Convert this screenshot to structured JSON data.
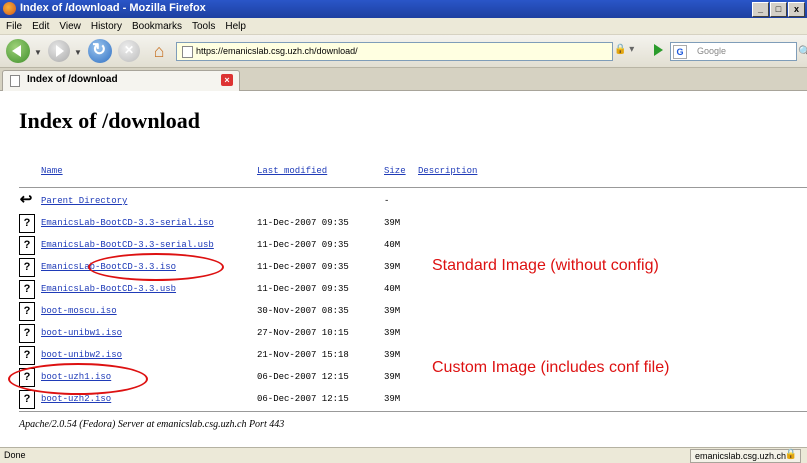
{
  "window": {
    "title": "Index of /download - Mozilla Firefox",
    "buttons": [
      "_",
      "□",
      "x"
    ]
  },
  "menu": [
    "File",
    "Edit",
    "View",
    "History",
    "Bookmarks",
    "Tools",
    "Help"
  ],
  "navbar": {
    "url": "https://emanicslab.csg.uzh.ch/download/",
    "search_placeholder": "Google"
  },
  "tab": {
    "label": "Index of /download"
  },
  "page": {
    "title": "Index of /download",
    "columns": {
      "name": "Name",
      "modified": "Last modified",
      "size": "Size",
      "description": "Description"
    },
    "rows": [
      {
        "name": "Parent Directory",
        "modified": "",
        "size": "-",
        "icon": "parent-directory-icon"
      },
      {
        "name": "EmanicsLab-BootCD-3.3-serial.iso",
        "modified": "11-Dec-2007 09:35",
        "size": "39M",
        "icon": "unknown-file-icon"
      },
      {
        "name": "EmanicsLab-BootCD-3.3-serial.usb",
        "modified": "11-Dec-2007 09:35",
        "size": "40M",
        "icon": "unknown-file-icon"
      },
      {
        "name": "EmanicsLab-BootCD-3.3.iso",
        "modified": "11-Dec-2007 09:35",
        "size": "39M",
        "icon": "unknown-file-icon"
      },
      {
        "name": "EmanicsLab-BootCD-3.3.usb",
        "modified": "11-Dec-2007 09:35",
        "size": "40M",
        "icon": "unknown-file-icon"
      },
      {
        "name": "boot-moscu.iso",
        "modified": "30-Nov-2007 08:35",
        "size": "39M",
        "icon": "unknown-file-icon"
      },
      {
        "name": "boot-unibw1.iso",
        "modified": "27-Nov-2007 10:15",
        "size": "39M",
        "icon": "unknown-file-icon"
      },
      {
        "name": "boot-unibw2.iso",
        "modified": "21-Nov-2007 15:18",
        "size": "39M",
        "icon": "unknown-file-icon"
      },
      {
        "name": "boot-uzh1.iso",
        "modified": "06-Dec-2007 12:15",
        "size": "39M",
        "icon": "unknown-file-icon"
      },
      {
        "name": "boot-uzh2.iso",
        "modified": "06-Dec-2007 12:15",
        "size": "39M",
        "icon": "unknown-file-icon"
      }
    ],
    "server_signature": "Apache/2.0.54 (Fedora) Server at emanicslab.csg.uzh.ch Port 443"
  },
  "annotations": {
    "standard": "Standard Image (without config)",
    "custom": "Custom Image (includes conf file)"
  },
  "status": {
    "text": "Done",
    "site": "emanicslab.csg.uzh.ch"
  },
  "colors": {
    "link": "#1f3bb8",
    "annotation": "#dd1111",
    "titlebar": "#2a56c8"
  }
}
